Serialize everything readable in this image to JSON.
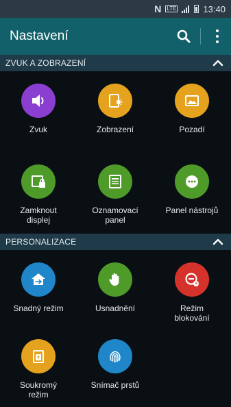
{
  "statusbar": {
    "time": "13:40",
    "network": "LTE"
  },
  "appbar": {
    "title": "Nastavení"
  },
  "sections": [
    {
      "title": "ZVUK A ZOBRAZENÍ",
      "items": [
        {
          "label": "Zvuk",
          "icon": "speaker-icon",
          "color": "#8a3fd1"
        },
        {
          "label": "Zobrazení",
          "icon": "display-icon",
          "color": "#e4a21e"
        },
        {
          "label": "Pozadí",
          "icon": "wallpaper-icon",
          "color": "#e4a21e"
        },
        {
          "label": "Zamknout\ndisplej",
          "icon": "lock-screen-icon",
          "color": "#4f9b2a"
        },
        {
          "label": "Oznamovací\npanel",
          "icon": "notification-panel-icon",
          "color": "#4f9b2a"
        },
        {
          "label": "Panel nástrojů",
          "icon": "toolbox-icon",
          "color": "#4f9b2a"
        }
      ]
    },
    {
      "title": "PERSONALIZACE",
      "items": [
        {
          "label": "Snadný režim",
          "icon": "easy-mode-icon",
          "color": "#1f86c9"
        },
        {
          "label": "Usnadnění",
          "icon": "hand-icon",
          "color": "#4f9b2a"
        },
        {
          "label": "Režim\nblokování",
          "icon": "blocking-mode-icon",
          "color": "#d4322b"
        },
        {
          "label": "Soukromý\nrežim",
          "icon": "private-mode-icon",
          "color": "#e4a21e"
        },
        {
          "label": "Snímač prstů",
          "icon": "fingerprint-icon",
          "color": "#1f86c9"
        }
      ]
    }
  ]
}
